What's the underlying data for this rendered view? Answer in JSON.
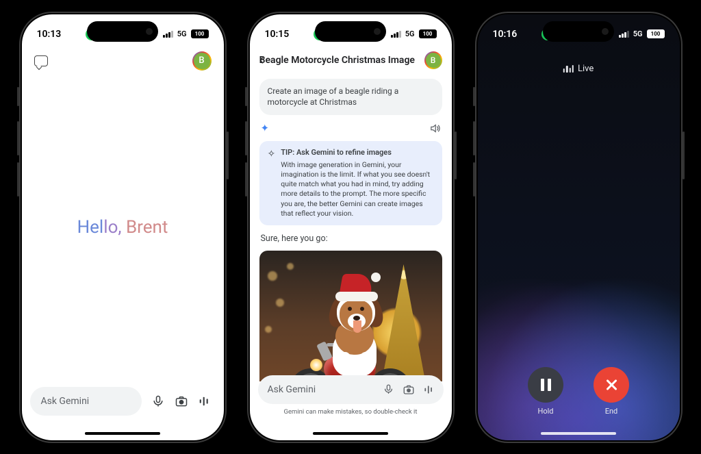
{
  "status": {
    "network": "5G",
    "battery": "100"
  },
  "screen1": {
    "time": "10:13",
    "avatar_initial": "B",
    "hello_part1": "Hel",
    "hello_part2": "lo, ",
    "hello_part3": "Brent",
    "input_placeholder": "Ask Gemini"
  },
  "screen2": {
    "time": "10:15",
    "avatar_initial": "B",
    "title": "Beagle Motorcycle Christmas Image",
    "user_prompt": "Create an image of a beagle riding a motorcycle at Christmas",
    "tip_title": "TIP: Ask Gemini to refine images",
    "tip_body": "With image generation in Gemini, your imagination is the limit. If what you see doesn't quite match what you had in mind, try adding more details to the prompt. The more specific you are, the better Gemini can create images that reflect your vision.",
    "sure": "Sure, here you go:",
    "input_placeholder": "Ask Gemini",
    "disclaimer": "Gemini can make mistakes, so double-check it"
  },
  "screen3": {
    "time": "10:16",
    "live": "Live",
    "hold": "Hold",
    "end": "End"
  }
}
